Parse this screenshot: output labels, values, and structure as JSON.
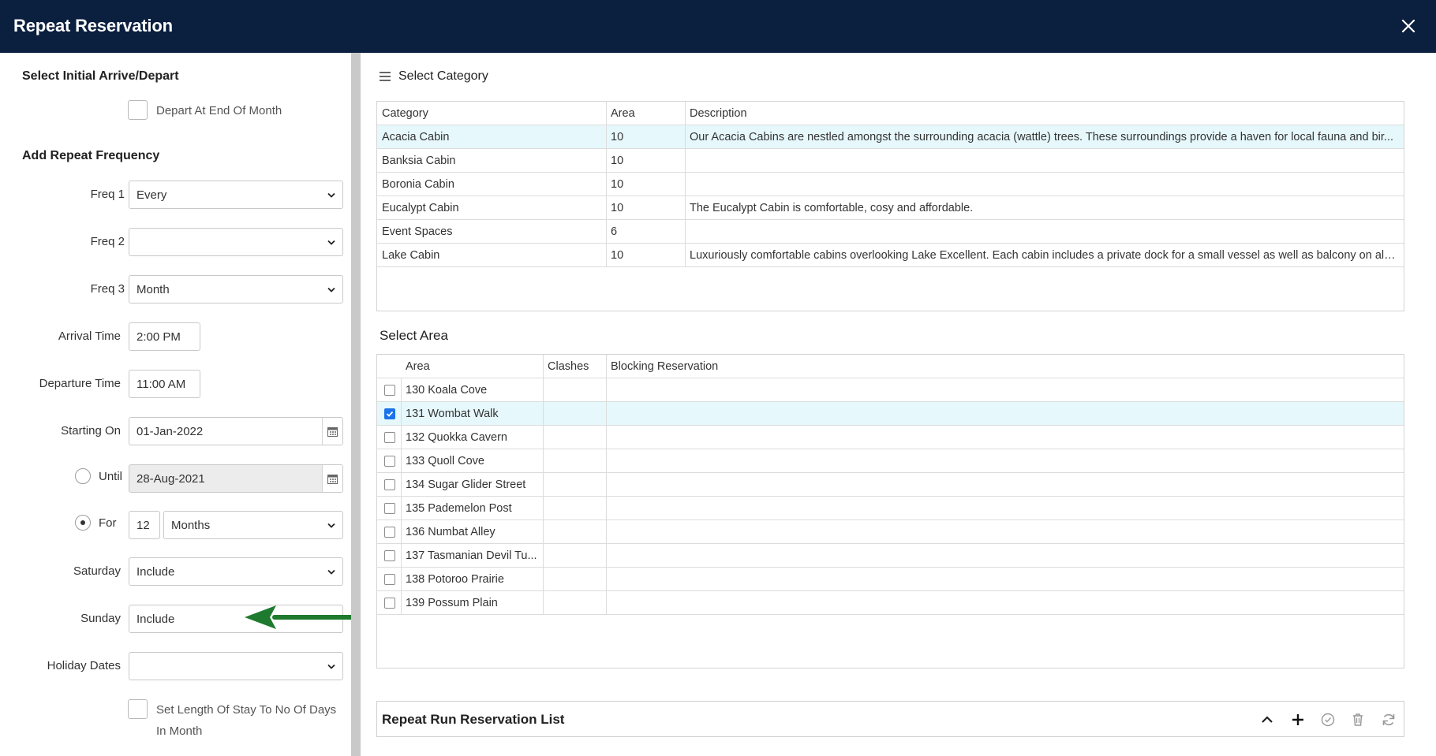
{
  "window": {
    "title": "Repeat Reservation"
  },
  "left": {
    "initial_section": "Select Initial Arrive/Depart",
    "depart_end_of_month": {
      "label": "Depart At End Of Month",
      "checked": false
    },
    "repeat_section": "Add Repeat Frequency",
    "freq1": {
      "label": "Freq 1",
      "value": "Every"
    },
    "freq2": {
      "label": "Freq 2",
      "value": ""
    },
    "freq3": {
      "label": "Freq 3",
      "value": "Month"
    },
    "arrival_time": {
      "label": "Arrival Time",
      "value": "2:00 PM"
    },
    "departure_time": {
      "label": "Departure Time",
      "value": "11:00 AM"
    },
    "starting_on": {
      "label": "Starting On",
      "value": "01-Jan-2022"
    },
    "until": {
      "label": "Until",
      "value": "28-Aug-2021",
      "selected": false
    },
    "for": {
      "label": "For",
      "count": "12",
      "unit": "Months",
      "selected": true
    },
    "saturday": {
      "label": "Saturday",
      "value": "Include"
    },
    "sunday": {
      "label": "Sunday",
      "value": "Include"
    },
    "holiday_dates": {
      "label": "Holiday Dates",
      "value": ""
    },
    "set_length": {
      "label_line1": "Set Length Of Stay To No Of Days",
      "label_line2": "In Month",
      "checked": false
    }
  },
  "category": {
    "title": "Select Category",
    "columns": [
      "Category",
      "Area",
      "Description"
    ],
    "rows": [
      {
        "category": "Acacia Cabin",
        "area": "10",
        "description": "Our Acacia Cabins are nestled amongst the surrounding acacia (wattle) trees. These surroundings provide a haven for local fauna and bir...",
        "selected": true
      },
      {
        "category": "Banksia Cabin",
        "area": "10",
        "description": "",
        "selected": false
      },
      {
        "category": "Boronia Cabin",
        "area": "10",
        "description": "",
        "selected": false
      },
      {
        "category": "Eucalypt Cabin",
        "area": "10",
        "description": "The Eucalypt Cabin is comfortable, cosy and affordable.",
        "selected": false
      },
      {
        "category": "Event Spaces",
        "area": "6",
        "description": "",
        "selected": false
      },
      {
        "category": "Lake Cabin",
        "area": "10",
        "description": "Luxuriously comfortable cabins overlooking Lake Excellent. Each cabin includes a private dock for a small vessel as well as balcony on all ...",
        "selected": false
      }
    ]
  },
  "area": {
    "title": "Select Area",
    "columns": [
      "Area",
      "Clashes",
      "Blocking Reservation"
    ],
    "rows": [
      {
        "area": "130 Koala Cove",
        "checked": false
      },
      {
        "area": "131 Wombat Walk",
        "checked": true
      },
      {
        "area": "132 Quokka Cavern",
        "checked": false
      },
      {
        "area": "133 Quoll Cove",
        "checked": false
      },
      {
        "area": "134 Sugar Glider Street",
        "checked": false
      },
      {
        "area": "135 Pademelon Post",
        "checked": false
      },
      {
        "area": "136 Numbat Alley",
        "checked": false
      },
      {
        "area": "137 Tasmanian Devil Tu...",
        "checked": false
      },
      {
        "area": "138 Potoroo Prairie",
        "checked": false
      },
      {
        "area": "139 Possum Plain",
        "checked": false
      }
    ]
  },
  "repeat_list": {
    "title": "Repeat Run Reservation List"
  },
  "colors": {
    "titlebar": "#0b1f3f",
    "selected_row": "#e6f8fc",
    "annotation_arrow": "#1e7a2e"
  }
}
